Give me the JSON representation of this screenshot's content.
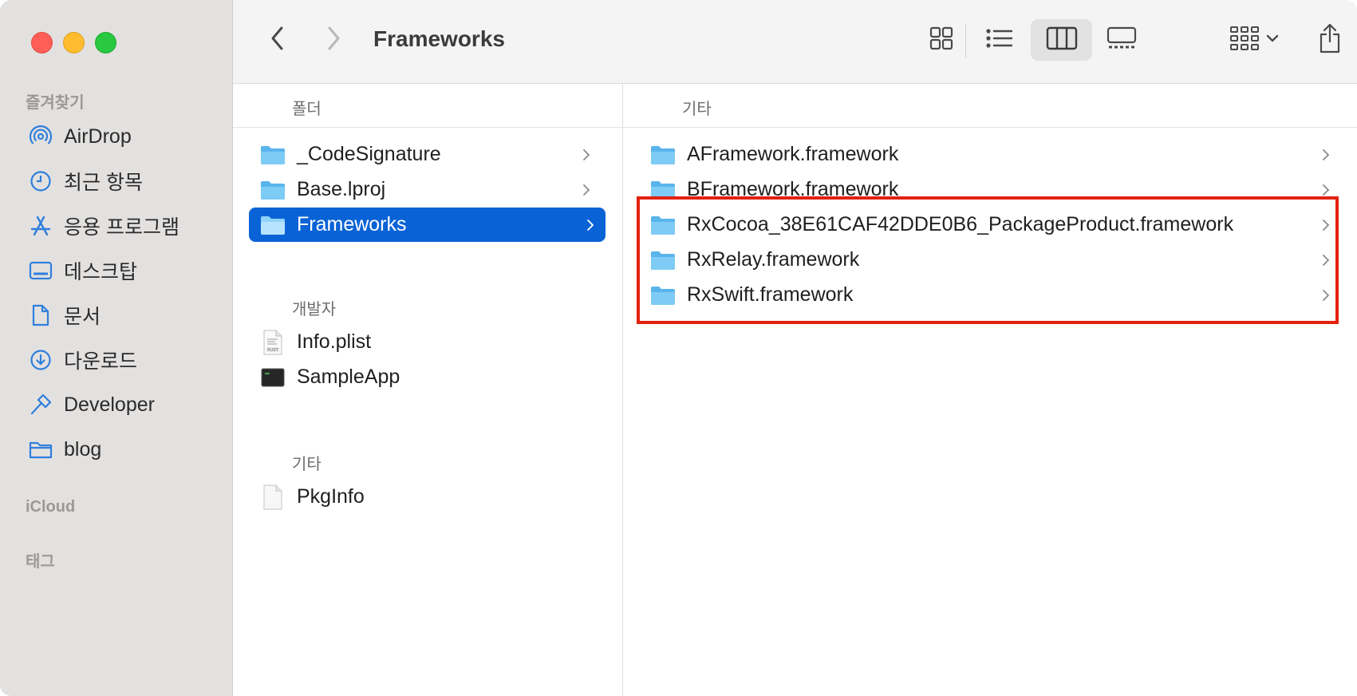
{
  "window": {
    "title": "Frameworks"
  },
  "sidebar": {
    "favorites_label": "즐겨찾기",
    "items": [
      {
        "label": "AirDrop",
        "icon": "airdrop-icon"
      },
      {
        "label": "최근 항목",
        "icon": "clock-icon"
      },
      {
        "label": "응용 프로그램",
        "icon": "applications-icon"
      },
      {
        "label": "데스크탑",
        "icon": "desktop-icon"
      },
      {
        "label": "문서",
        "icon": "document-icon"
      },
      {
        "label": "다운로드",
        "icon": "download-icon"
      },
      {
        "label": "Developer",
        "icon": "hammer-icon"
      },
      {
        "label": "blog",
        "icon": "folder-icon"
      }
    ],
    "icloud_label": "iCloud",
    "tags_label": "태그"
  },
  "toolbar": {
    "back_icon": "chevron-left-icon",
    "forward_icon": "chevron-right-icon",
    "view_modes": [
      "icon-view",
      "list-view",
      "column-view",
      "gallery-view"
    ],
    "selected_view": "column-view",
    "group_icon": "group-by-icon",
    "share_icon": "share-icon"
  },
  "column1": {
    "header": "폴더",
    "folders": [
      {
        "name": "_CodeSignature"
      },
      {
        "name": "Base.lproj"
      },
      {
        "name": "Frameworks",
        "selected": true
      }
    ],
    "developer_group_label": "개발자",
    "developer_items": [
      {
        "name": "Info.plist",
        "icon": "plist-file-icon"
      },
      {
        "name": "SampleApp",
        "icon": "executable-icon"
      }
    ],
    "other_group_label": "기타",
    "other_items": [
      {
        "name": "PkgInfo",
        "icon": "blank-file-icon"
      }
    ]
  },
  "column2": {
    "header": "기타",
    "items": [
      {
        "name": "AFramework.framework"
      },
      {
        "name": "BFramework.framework"
      },
      {
        "name": "RxCocoa_38E61CAF42DDE0B6_PackageProduct.framework"
      },
      {
        "name": "RxRelay.framework"
      },
      {
        "name": "RxSwift.framework"
      }
    ]
  },
  "colors": {
    "accent": "#0a63d6",
    "highlight_border": "#e3210d",
    "folder_blue": "#6fc3f3"
  }
}
